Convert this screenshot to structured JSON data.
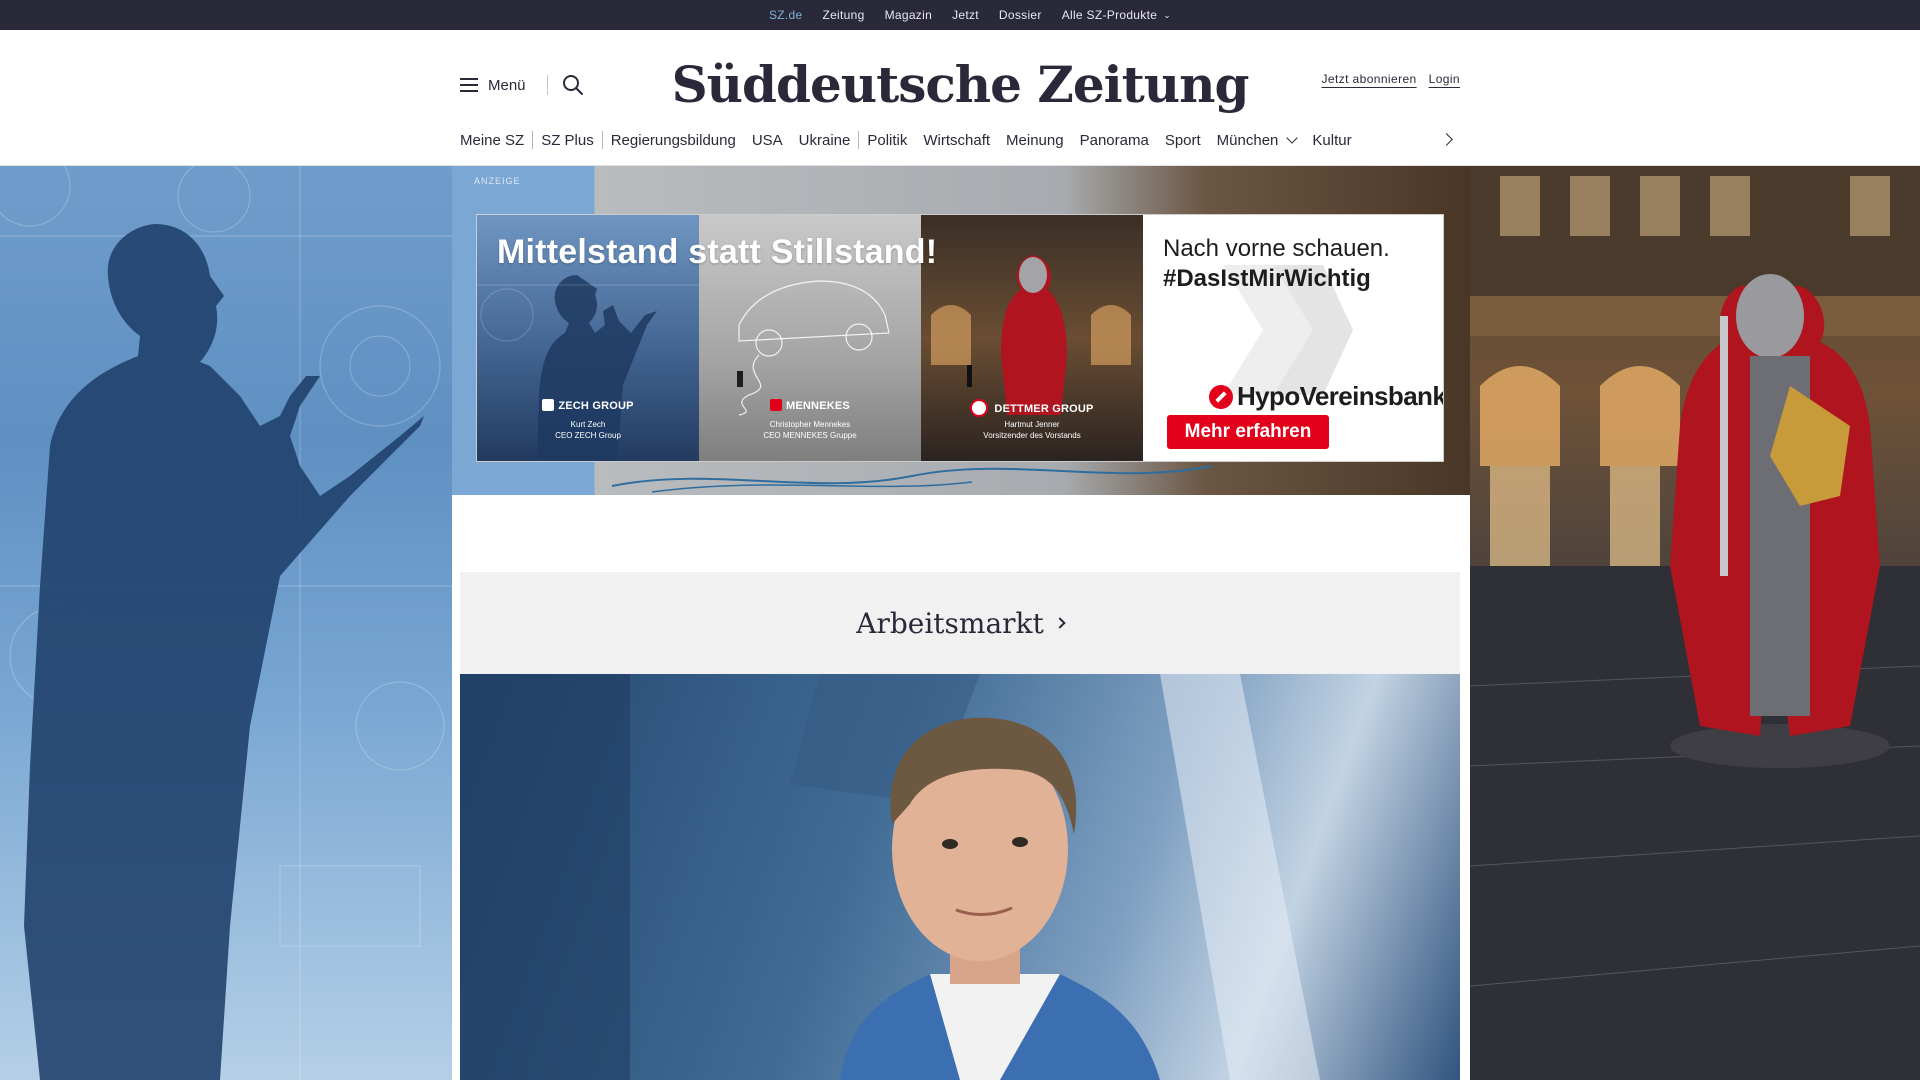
{
  "topbar": {
    "items": [
      "SZ.de",
      "Zeitung",
      "Magazin",
      "Jetzt",
      "Dossier",
      "Alle SZ-Produkte"
    ],
    "active": "SZ.de"
  },
  "header": {
    "menu_label": "Menü",
    "logo_text": "Süddeutsche Zeitung",
    "subscribe_label": "Jetzt abonnieren",
    "login_label": "Login"
  },
  "nav": {
    "items": [
      "Meine SZ",
      "SZ Plus",
      "Regierungsbildung",
      "USA",
      "Ukraine",
      "Politik",
      "Wirtschaft",
      "Meinung",
      "Panorama",
      "Sport",
      "München",
      "Kultur"
    ]
  },
  "ad": {
    "label": "ANZEIGE",
    "headline": "Mittelstand statt Stillstand!",
    "companies": [
      {
        "name": "ZECH GROUP",
        "person": "Kurt Zech",
        "role": "CEO ZECH Group"
      },
      {
        "name": "MENNEKES",
        "person": "Christopher Mennekes",
        "role": "CEO MENNEKES Gruppe"
      },
      {
        "name": "DETTMER GROUP",
        "person": "Hartmut Jenner",
        "role": "Vorsitzender des Vorstands"
      }
    ],
    "slogan_line1": "Nach vorne schauen.",
    "slogan_line2": "#DasIstMirWichtig",
    "bank_name": "HypoVereinsbank",
    "cta_label": "Mehr erfahren",
    "colors": {
      "brand_red": "#e2001a"
    }
  },
  "section": {
    "title": "Arbeitsmarkt"
  },
  "colors": {
    "topbar_bg": "#29293a",
    "active_link": "#7fb3d5",
    "text": "#29293a",
    "section_bg": "#f1f1f1"
  }
}
